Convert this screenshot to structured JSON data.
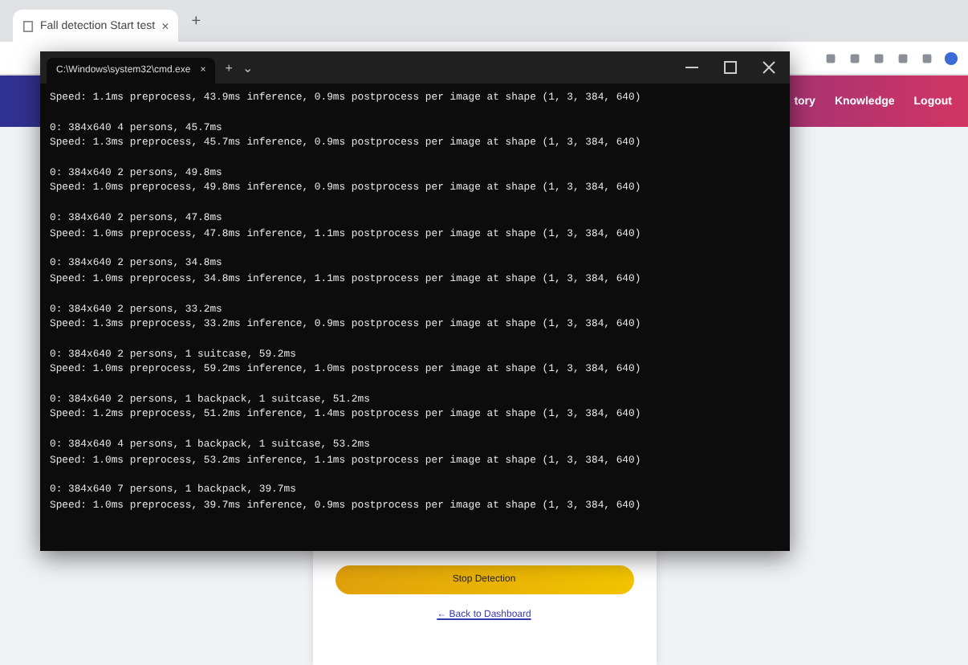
{
  "browser": {
    "tab": {
      "title": "Fall detection Start test",
      "close": "×"
    },
    "new_tab": "+"
  },
  "nav": {
    "items": [
      "tory",
      "Knowledge",
      "Logout"
    ]
  },
  "card": {
    "button": "Stop Detection",
    "link": "← Back to Dashboard"
  },
  "terminal": {
    "tab_title": "C:\\Windows\\system32\\cmd.exe",
    "tab_close": "×",
    "new_tab": "+",
    "dropdown": "⌄",
    "blocks": [
      [
        "Speed: 1.1ms preprocess, 43.9ms inference, 0.9ms postprocess per image at shape (1, 3, 384, 640)"
      ],
      [
        "0: 384x640 4 persons, 45.7ms",
        "Speed: 1.3ms preprocess, 45.7ms inference, 0.9ms postprocess per image at shape (1, 3, 384, 640)"
      ],
      [
        "0: 384x640 2 persons, 49.8ms",
        "Speed: 1.0ms preprocess, 49.8ms inference, 0.9ms postprocess per image at shape (1, 3, 384, 640)"
      ],
      [
        "0: 384x640 2 persons, 47.8ms",
        "Speed: 1.0ms preprocess, 47.8ms inference, 1.1ms postprocess per image at shape (1, 3, 384, 640)"
      ],
      [
        "0: 384x640 2 persons, 34.8ms",
        "Speed: 1.0ms preprocess, 34.8ms inference, 1.1ms postprocess per image at shape (1, 3, 384, 640)"
      ],
      [
        "0: 384x640 2 persons, 33.2ms",
        "Speed: 1.3ms preprocess, 33.2ms inference, 0.9ms postprocess per image at shape (1, 3, 384, 640)"
      ],
      [
        "0: 384x640 2 persons, 1 suitcase, 59.2ms",
        "Speed: 1.0ms preprocess, 59.2ms inference, 1.0ms postprocess per image at shape (1, 3, 384, 640)"
      ],
      [
        "0: 384x640 2 persons, 1 backpack, 1 suitcase, 51.2ms",
        "Speed: 1.2ms preprocess, 51.2ms inference, 1.4ms postprocess per image at shape (1, 3, 384, 640)"
      ],
      [
        "0: 384x640 4 persons, 1 backpack, 1 suitcase, 53.2ms",
        "Speed: 1.0ms preprocess, 53.2ms inference, 1.1ms postprocess per image at shape (1, 3, 384, 640)"
      ],
      [
        "0: 384x640 7 persons, 1 backpack, 39.7ms",
        "Speed: 1.0ms preprocess, 39.7ms inference, 0.9ms postprocess per image at shape (1, 3, 384, 640)"
      ]
    ]
  }
}
